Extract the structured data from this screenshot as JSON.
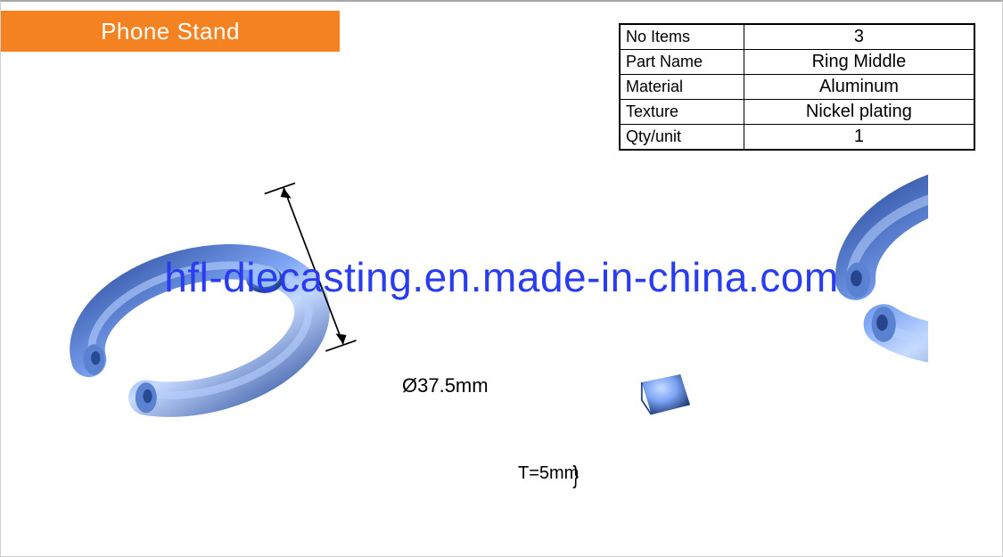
{
  "title": "Phone Stand",
  "spec_rows": [
    {
      "label": "No Items",
      "value": "3"
    },
    {
      "label": "Part Name",
      "value": "Ring Middle"
    },
    {
      "label": "Material",
      "value": "Aluminum"
    },
    {
      "label": "Texture",
      "value": "Nickel plating"
    },
    {
      "label": "Qty/unit",
      "value": "1"
    }
  ],
  "dimensions": {
    "diameter_label": "Ø37.5mm",
    "thickness_label": "T=5mm"
  },
  "watermark": "hfl-diecasting.en.made-in-china.com"
}
